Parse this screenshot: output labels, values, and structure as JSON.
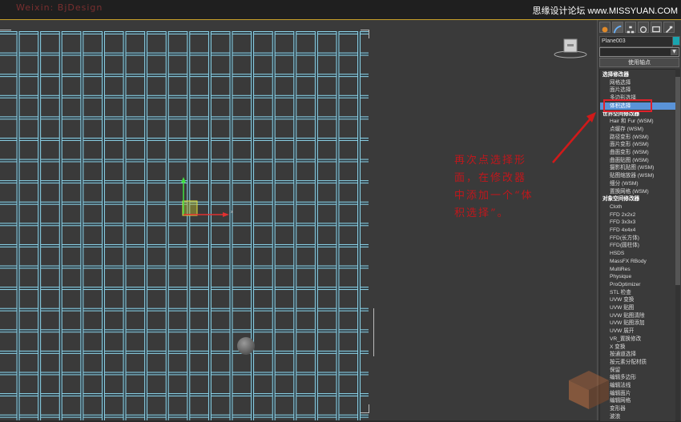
{
  "topbar": {
    "watermark": "Weixin: BjDesign",
    "brand": "思缘设计论坛 www.MISSYUAN.COM"
  },
  "viewport": {
    "gizmo_x_label": "x",
    "gizmo_y_label": "y",
    "note": "再次点选择形面，在修改器中添加一个“体积选择”。"
  },
  "panel": {
    "tabs": [
      "create-icon",
      "modify-icon",
      "hierarchy-icon",
      "motion-icon",
      "display-icon",
      "utilities-icon"
    ],
    "object_name": "Plane003",
    "object_color": "#1aa5b0",
    "pivot_button": "使用轴点",
    "modifiers": [
      {
        "label": "选择修改器",
        "kind": "hdr"
      },
      {
        "label": "网格选择",
        "kind": "item"
      },
      {
        "label": "面片选择",
        "kind": "item"
      },
      {
        "label": "多边形选择",
        "kind": "item"
      },
      {
        "label": "体积选择",
        "kind": "item",
        "selected": true
      },
      {
        "label": "世界空间修改器",
        "kind": "hdr"
      },
      {
        "label": "Hair 和 Fur (WSM)",
        "kind": "item"
      },
      {
        "label": "点缓存 (WSM)",
        "kind": "item"
      },
      {
        "label": "路径变形 (WSM)",
        "kind": "item"
      },
      {
        "label": "面片变形 (WSM)",
        "kind": "item"
      },
      {
        "label": "曲面变形 (WSM)",
        "kind": "item"
      },
      {
        "label": "曲面贴图 (WSM)",
        "kind": "item"
      },
      {
        "label": "摄影机贴图 (WSM)",
        "kind": "item"
      },
      {
        "label": "贴图缩放器 (WSM)",
        "kind": "item"
      },
      {
        "label": "细分 (WSM)",
        "kind": "item"
      },
      {
        "label": "置换网格 (WSM)",
        "kind": "item"
      },
      {
        "label": "对象空间修改器",
        "kind": "hdr"
      },
      {
        "label": "Cloth",
        "kind": "item"
      },
      {
        "label": "FFD 2x2x2",
        "kind": "item"
      },
      {
        "label": "FFD 3x3x3",
        "kind": "item"
      },
      {
        "label": "FFD 4x4x4",
        "kind": "item"
      },
      {
        "label": "FFD(长方体)",
        "kind": "item"
      },
      {
        "label": "FFD(圆柱体)",
        "kind": "item"
      },
      {
        "label": "HSDS",
        "kind": "item"
      },
      {
        "label": "MassFX RBody",
        "kind": "item"
      },
      {
        "label": "MultiRes",
        "kind": "item"
      },
      {
        "label": "Physique",
        "kind": "item"
      },
      {
        "label": "ProOptimizer",
        "kind": "item"
      },
      {
        "label": "STL 检查",
        "kind": "item"
      },
      {
        "label": "UVW 变换",
        "kind": "item"
      },
      {
        "label": "UVW 贴图",
        "kind": "item"
      },
      {
        "label": "UVW 贴图清除",
        "kind": "item"
      },
      {
        "label": "UVW 贴图添加",
        "kind": "item"
      },
      {
        "label": "UVW 展开",
        "kind": "item"
      },
      {
        "label": "VR_置换修改",
        "kind": "item"
      },
      {
        "label": "X 变换",
        "kind": "item"
      },
      {
        "label": "按通道选择",
        "kind": "item"
      },
      {
        "label": "按元素分配材质",
        "kind": "item"
      },
      {
        "label": "保留",
        "kind": "item"
      },
      {
        "label": "编辑多边形",
        "kind": "item"
      },
      {
        "label": "编辑法线",
        "kind": "item"
      },
      {
        "label": "编辑面片",
        "kind": "item"
      },
      {
        "label": "编辑网格",
        "kind": "item"
      },
      {
        "label": "变形器",
        "kind": "item"
      },
      {
        "label": "波浪",
        "kind": "item"
      }
    ]
  },
  "colors": {
    "accent": "#c8a02a",
    "note": "#c0171c",
    "selection": "#5a93d8",
    "grid_line": "#8fd8ee"
  }
}
